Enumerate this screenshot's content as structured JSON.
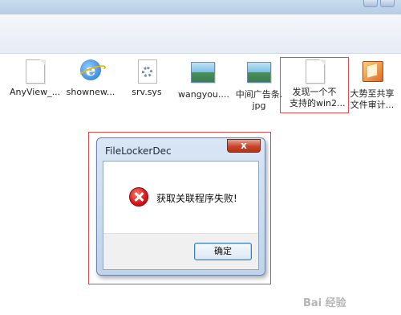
{
  "files": [
    {
      "label": "AnyView_...",
      "icon": "document-icon"
    },
    {
      "label": "shownew...",
      "icon": "ie-icon"
    },
    {
      "label": "srv.sys",
      "icon": "system-file-icon"
    },
    {
      "label": "wangyou....",
      "icon": "image-icon"
    },
    {
      "label_line1": "中间广告条.",
      "label_line2": "jpg",
      "icon": "image-icon"
    },
    {
      "label_line1": "发现一个不",
      "label_line2": "支持的win2...",
      "icon": "document-icon"
    },
    {
      "label_line1": "大势至共享",
      "label_line2": "文件审计...",
      "icon": "app-icon"
    }
  ],
  "dialog": {
    "title": "FileLockerDec",
    "close_label": "x",
    "message": "获取关联程序失败!",
    "ok_label": "确定"
  },
  "watermark": "Bai 经验",
  "colors": {
    "annotation_red": "#e04b4b",
    "close_button_red": "#c8452c"
  }
}
